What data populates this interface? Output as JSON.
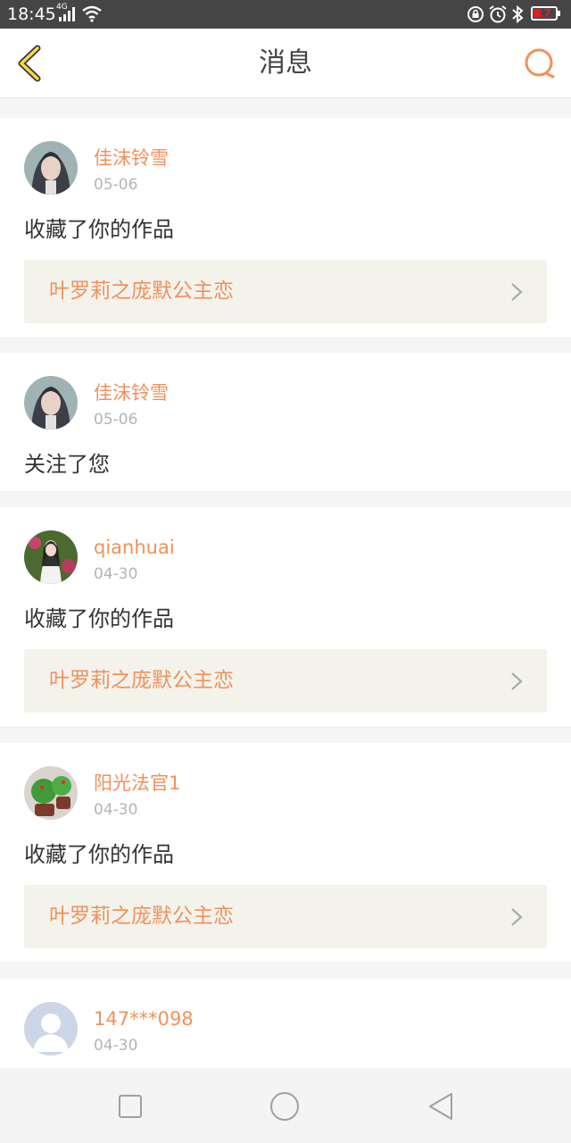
{
  "status_bar": {
    "time": "18:45",
    "network": "4G",
    "battery": "17"
  },
  "header": {
    "title": "消息",
    "back_icon": "chevron-left-icon",
    "search_icon": "search-icon"
  },
  "colors": {
    "accent": "#f0915a",
    "back_arrow": "#f5d84a",
    "work_bg": "#f3f3ec"
  },
  "messages": [
    {
      "name": "佳沫铃雪",
      "date": "05-06",
      "action": "收藏了你的作品",
      "work": "叶罗莉之庞默公主恋"
    },
    {
      "name": "佳沫铃雪",
      "date": "05-06",
      "action": "关注了您"
    },
    {
      "name": "qianhuai",
      "date": "04-30",
      "action": "收藏了你的作品",
      "work": "叶罗莉之庞默公主恋"
    },
    {
      "name": "阳光法官1",
      "date": "04-30",
      "action": "收藏了你的作品",
      "work": "叶罗莉之庞默公主恋"
    },
    {
      "name": "147***098",
      "date": "04-30"
    }
  ],
  "nav": [
    "recent-apps-icon",
    "home-icon",
    "back-icon"
  ]
}
